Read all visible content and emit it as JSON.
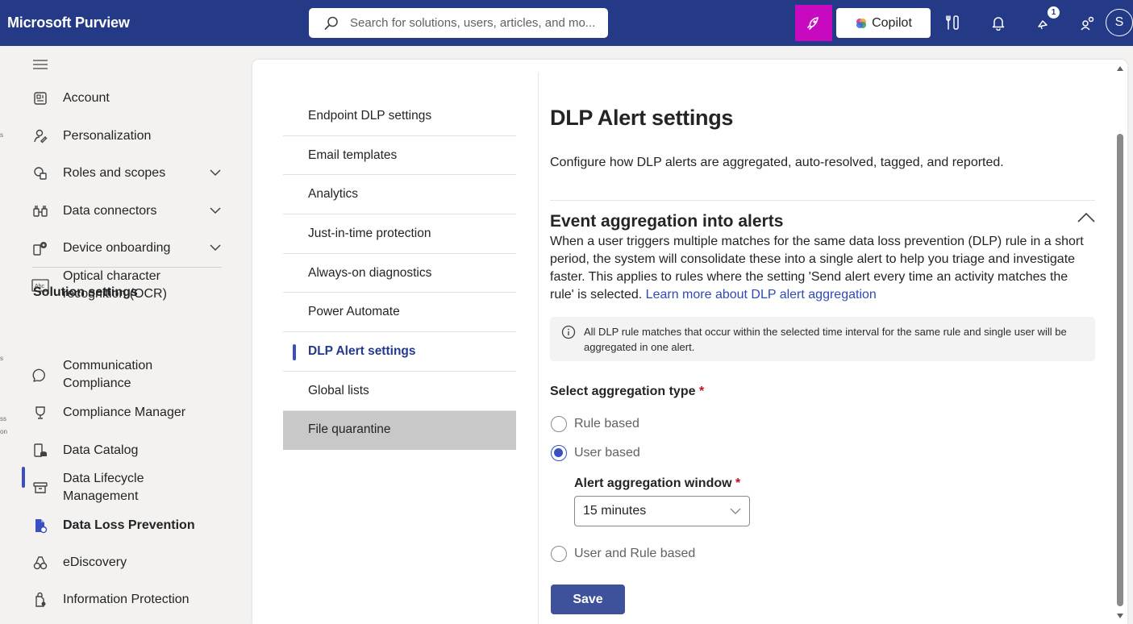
{
  "app": {
    "title": "Microsoft Purview"
  },
  "search": {
    "placeholder": "Search for solutions, users, articles, and mo..."
  },
  "topbar": {
    "copilot_label": "Copilot",
    "notification_count": "1",
    "avatar_initial": "S"
  },
  "leftnav": {
    "items": [
      {
        "label": "Account",
        "icon": "account-icon"
      },
      {
        "label": "Personalization",
        "icon": "personalization-icon"
      },
      {
        "label": "Roles and scopes",
        "icon": "roles-icon",
        "expandable": true
      },
      {
        "label": "Data connectors",
        "icon": "data-connectors-icon",
        "expandable": true
      },
      {
        "label": "Device onboarding",
        "icon": "device-onboarding-icon",
        "expandable": true
      },
      {
        "label": "Optical character recognition (OCR)",
        "icon": "ocr-icon"
      }
    ],
    "section_heading": "Solution settings",
    "solution_items": [
      {
        "label": "Communication Compliance",
        "icon": "communication-compliance-icon"
      },
      {
        "label": "Compliance Manager",
        "icon": "compliance-manager-icon"
      },
      {
        "label": "Data Catalog",
        "icon": "data-catalog-icon"
      },
      {
        "label": "Data Lifecycle Management",
        "icon": "data-lifecycle-icon"
      },
      {
        "label": "Data Loss Prevention",
        "icon": "dlp-icon",
        "active": true
      },
      {
        "label": "eDiscovery",
        "icon": "ediscovery-icon"
      },
      {
        "label": "Information Protection",
        "icon": "information-protection-icon"
      }
    ]
  },
  "submenu": {
    "items": [
      "Endpoint DLP settings",
      "Email templates",
      "Analytics",
      "Just-in-time protection",
      "Always-on diagnostics",
      "Power Automate",
      "DLP Alert settings",
      "Global lists",
      "File quarantine"
    ],
    "active_index": 6,
    "hover_index": 8
  },
  "main": {
    "title": "DLP Alert settings",
    "description": "Configure how DLP alerts are aggregated, auto-resolved, tagged, and reported.",
    "section": {
      "title": "Event aggregation into alerts",
      "body": "When a user triggers multiple matches for the same data loss prevention (DLP) rule in a short period, the system will consolidate these into a single alert to help you triage and investigate faster. This applies to rules where the setting 'Send alert every time an activity matches the rule' is selected.",
      "link": "Learn more about DLP alert aggregation",
      "info": "All DLP rule matches that occur within the selected time interval for the same rule and single user will be aggregated in one alert."
    },
    "aggregation_type": {
      "label": "Select aggregation type",
      "required_mark": "*",
      "options": [
        "Rule based",
        "User based",
        "User and Rule based"
      ],
      "selected": "User based"
    },
    "window": {
      "label": "Alert aggregation window",
      "required_mark": "*",
      "value": "15 minutes"
    },
    "save_label": "Save"
  },
  "colors": {
    "topbar": "#253a87",
    "accent": "#3a4fc0",
    "pink": "#c70ac0",
    "link": "#2f4ab4"
  }
}
